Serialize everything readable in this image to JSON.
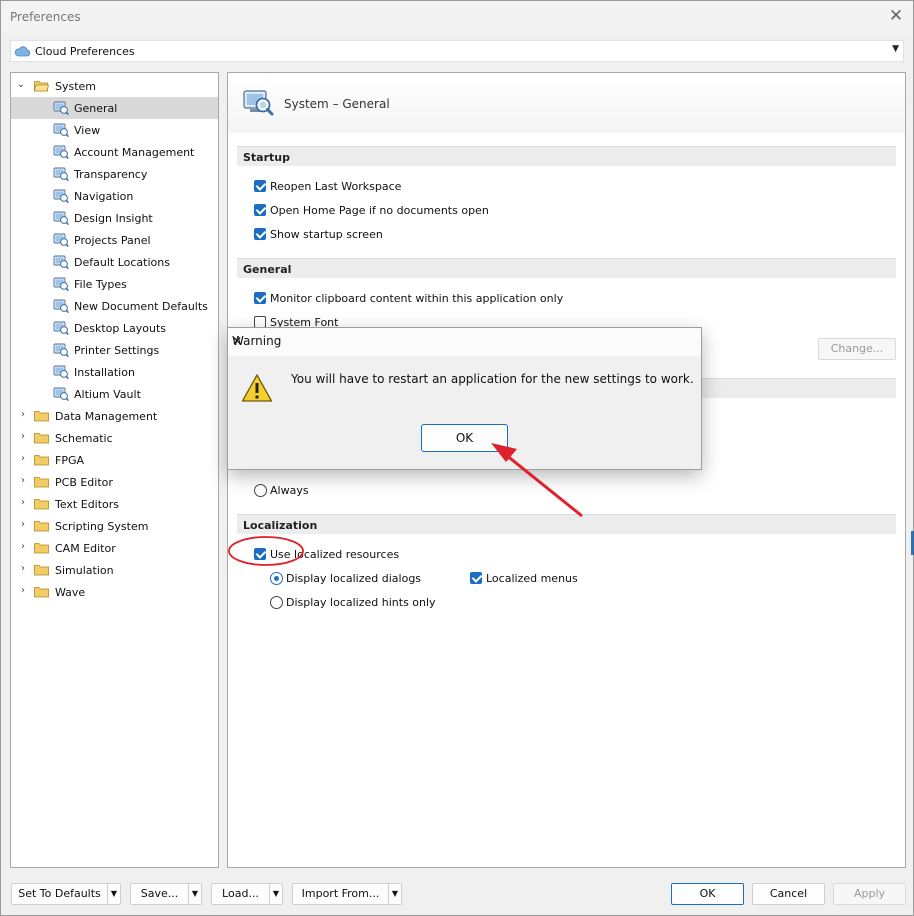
{
  "window": {
    "title": "Preferences",
    "close_glyph": "✕"
  },
  "cloud": {
    "label": "Cloud Preferences",
    "icon": "cloud-icon"
  },
  "tree": {
    "system": {
      "label": "System",
      "expanded": true
    },
    "system_children": [
      "General",
      "View",
      "Account Management",
      "Transparency",
      "Navigation",
      "Design Insight",
      "Projects Panel",
      "Default Locations",
      "File Types",
      "New Document Defaults",
      "Desktop Layouts",
      "Printer Settings",
      "Installation",
      "Altium Vault"
    ],
    "selected": "General",
    "other_groups": [
      "Data Management",
      "Schematic",
      "FPGA",
      "PCB Editor",
      "Text Editors",
      "Scripting System",
      "CAM Editor",
      "Simulation",
      "Wave"
    ]
  },
  "page": {
    "title": "System – General",
    "startup": {
      "heading": "Startup",
      "reopen": "Reopen Last Workspace",
      "home": "Open Home Page if no documents open",
      "splash": "Show startup screen"
    },
    "general": {
      "heading": "General",
      "monitor": "Monitor clipboard content within this application only",
      "sysfont": "System Font",
      "change": "Change..."
    },
    "always": "Always",
    "localization": {
      "heading": "Localization",
      "use": "Use localized resources",
      "dialogs": "Display localized dialogs",
      "menus": "Localized menus",
      "hints": "Display localized hints only"
    }
  },
  "footer": {
    "set_defaults": "Set To Defaults",
    "save": "Save...",
    "load": "Load...",
    "import": "Import From...",
    "ok": "OK",
    "cancel": "Cancel",
    "apply": "Apply"
  },
  "dialog": {
    "title": "Warning",
    "message": "You will have to restart an application for the new settings to work.",
    "ok": "OK",
    "close_glyph": "✕"
  },
  "colors": {
    "accent": "#1a6fc2",
    "annotation": "#e0202a"
  }
}
